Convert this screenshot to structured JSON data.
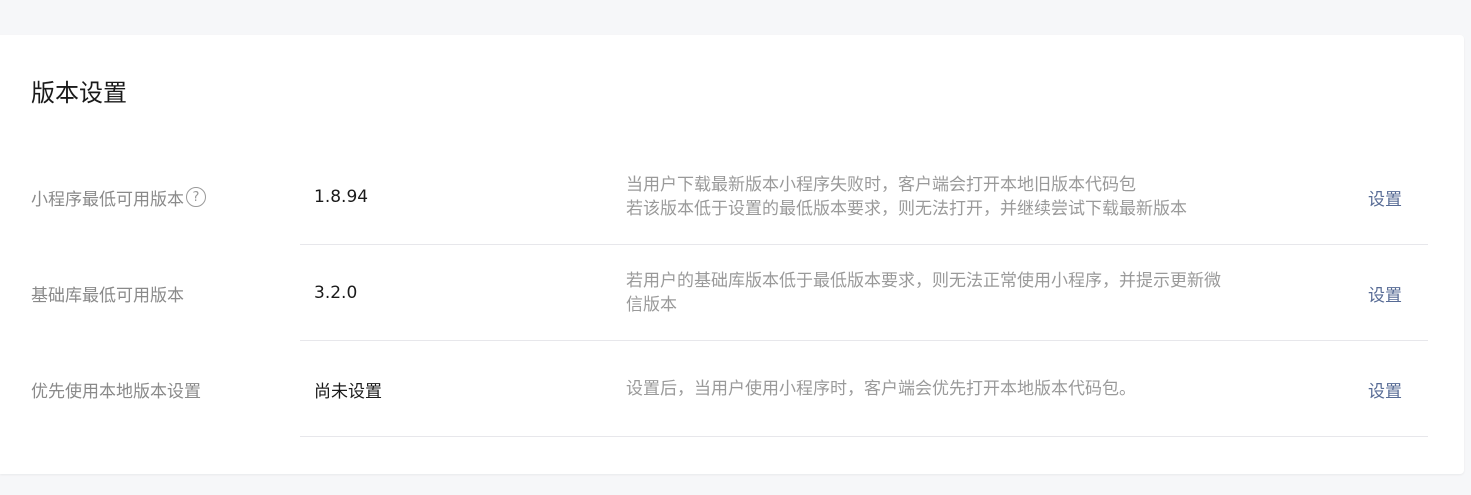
{
  "section": {
    "title": "版本设置"
  },
  "rows": [
    {
      "label": "小程序最低可用版本",
      "help_icon": "?",
      "value": "1.8.94",
      "desc_line1": "当用户下载最新版本小程序失败时，客户端会打开本地旧版本代码包",
      "desc_line2": "若该版本低于设置的最低版本要求，则无法打开，并继续尝试下载最新版本",
      "action": "设置"
    },
    {
      "label": "基础库最低可用版本",
      "value": "3.2.0",
      "desc_line1": "若用户的基础库版本低于最低版本要求，则无法正常使用小程序，并提示更新微",
      "desc_line2": "信版本",
      "action": "设置"
    },
    {
      "label": "优先使用本地版本设置",
      "value": "尚未设置",
      "desc_line1": "设置后，当用户使用小程序时，客户端会优先打开本地版本代码包。",
      "action": "设置"
    }
  ],
  "colors": {
    "page_bg": "#f6f7f9",
    "card_bg": "#ffffff",
    "link": "#576b95",
    "label": "#8a8a8a",
    "value": "#1a1a1a",
    "divider": "#e7e7eb"
  },
  "icons": {
    "help": "question-circle-icon"
  }
}
